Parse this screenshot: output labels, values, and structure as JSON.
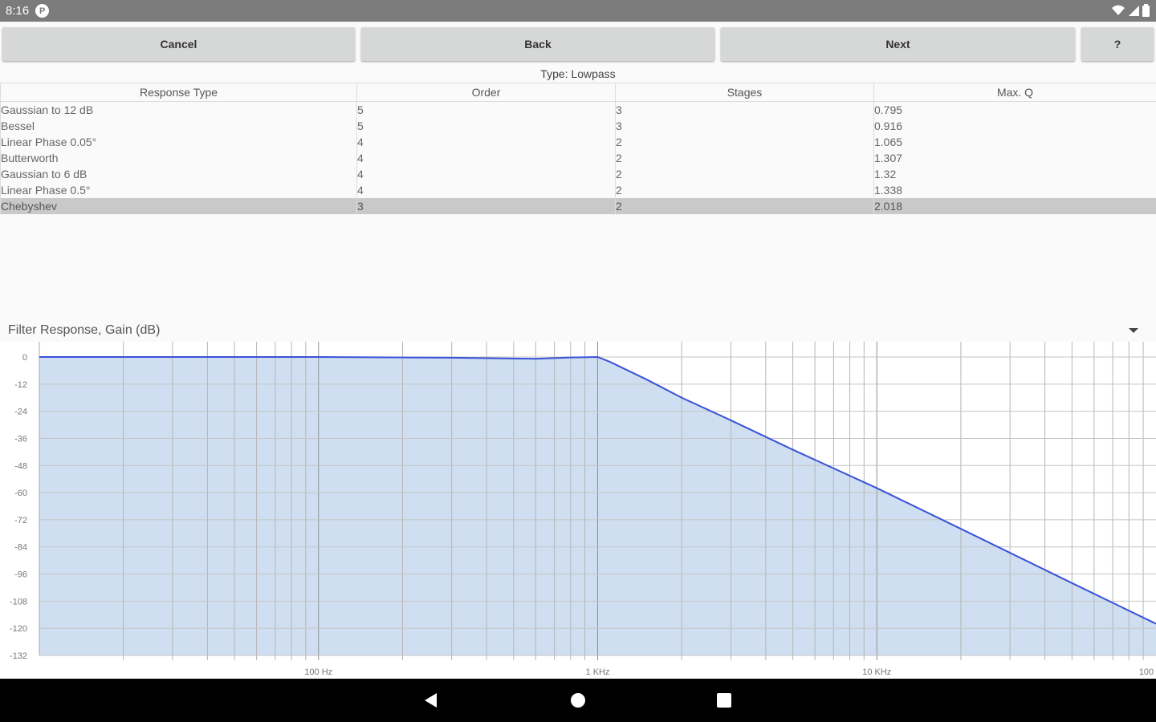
{
  "status_bar": {
    "time": "8:16",
    "app_icon": "P"
  },
  "buttons": {
    "cancel": "Cancel",
    "back": "Back",
    "next": "Next",
    "help": "?"
  },
  "type_label": "Type: Lowpass",
  "table": {
    "columns": [
      "Response Type",
      "Order",
      "Stages",
      "Max. Q"
    ],
    "rows": [
      [
        "Gaussian to 12 dB",
        "5",
        "3",
        "0.795"
      ],
      [
        "Bessel",
        "5",
        "3",
        "0.916"
      ],
      [
        "Linear Phase 0.05°",
        "4",
        "2",
        "1.065"
      ],
      [
        "Butterworth",
        "4",
        "2",
        "1.307"
      ],
      [
        "Gaussian to 6 dB",
        "4",
        "2",
        "1.32"
      ],
      [
        "Linear Phase 0.5°",
        "4",
        "2",
        "1.338"
      ],
      [
        "Chebyshev",
        "3",
        "2",
        "2.018"
      ]
    ],
    "selected_index": 6
  },
  "chart_title": "Filter Response, Gain (dB)",
  "chart_data": {
    "type": "area",
    "title": "Filter Response, Gain (dB)",
    "xlabel": "",
    "ylabel": "",
    "x_scale": "log",
    "xlim": [
      10,
      100000
    ],
    "ylim": [
      -132,
      0
    ],
    "yticks": [
      0,
      -12,
      -24,
      -36,
      -48,
      -60,
      -72,
      -84,
      -96,
      -108,
      -120,
      -132
    ],
    "y_tick_labels": [
      "0",
      "-12",
      "-24",
      "-36",
      "-48",
      "-60",
      "-72",
      "-84",
      "-96",
      "-108",
      "-120",
      "-132"
    ],
    "xticks": [
      100,
      1000,
      10000,
      100000
    ],
    "x_tick_labels": [
      "100 Hz",
      "1 KHz",
      "10 KHz",
      "100"
    ],
    "grid": true,
    "series": [
      {
        "color": "#3a52d8",
        "fill": "#cfdff1",
        "x": [
          10,
          100,
          300,
          600,
          800,
          1000,
          1100,
          1500,
          2000,
          3000,
          5000,
          10000,
          20000,
          50000,
          100000
        ],
        "y": [
          0,
          0,
          -0.3,
          -0.8,
          -0.2,
          0,
          -2,
          -10,
          -18,
          -28,
          -41,
          -58,
          -76,
          -100,
          -118
        ]
      }
    ]
  },
  "colors": {
    "status_bar": "#7b7b7b",
    "button": "#d6d7d7",
    "selected_row": "#c9c9c9",
    "line": "#3a52d8",
    "fill": "#cfdff1"
  }
}
